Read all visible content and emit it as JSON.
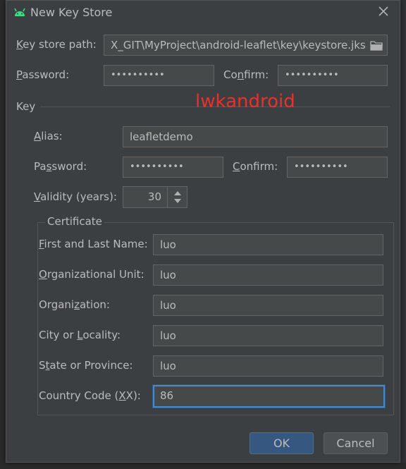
{
  "dialog": {
    "title": "New Key Store",
    "icon": "android-icon",
    "close": "close-icon"
  },
  "keystore": {
    "path_label_ul": "K",
    "path_label_rest": "ey store path:",
    "path_value": "X_GIT\\MyProject\\android-leaflet\\key\\keystore.jks",
    "password_label_ul": "P",
    "password_label_rest": "assword:",
    "password_value": "••••••••••",
    "confirm_label_a": "Co",
    "confirm_label_ul": "n",
    "confirm_label_b": "firm:",
    "confirm_value": "••••••••••"
  },
  "watermark": "lwkandroid",
  "key": {
    "section_label": "Key",
    "alias_label_ul": "A",
    "alias_label_rest": "lias:",
    "alias_value": "leafletdemo",
    "password_label_a": "Pa",
    "password_label_ul": "s",
    "password_label_b": "sword:",
    "password_value": "••••••••••",
    "confirm_label_ul": "C",
    "confirm_label_rest": "onfirm:",
    "confirm_value": "••••••••••",
    "validity_label_ul": "V",
    "validity_label_rest": "alidity (years):",
    "validity_value": "30"
  },
  "certificate": {
    "section_label": "Certificate",
    "first_last_ul": "F",
    "first_last_rest": "irst and Last Name:",
    "first_last_value": "luo",
    "org_unit_ul": "O",
    "org_unit_rest": "rganizational Unit:",
    "org_unit_value": "luo",
    "org_a": "Organi",
    "org_ul": "z",
    "org_b": "ation:",
    "org_value": "luo",
    "city_a": "City or ",
    "city_ul": "L",
    "city_b": "ocality:",
    "city_value": "luo",
    "state_a": "S",
    "state_ul": "t",
    "state_b": "ate or Province:",
    "state_value": "luo",
    "country_a": "Country Code (",
    "country_ul": "X",
    "country_b": "X):",
    "country_value": "86"
  },
  "buttons": {
    "ok": "OK",
    "cancel": "Cancel"
  },
  "colors": {
    "dialog_bg": "#3c3f41",
    "field_bg": "#45494a",
    "accent": "#4a88c7",
    "watermark": "#e8312f",
    "android_green": "#3ddc84"
  }
}
